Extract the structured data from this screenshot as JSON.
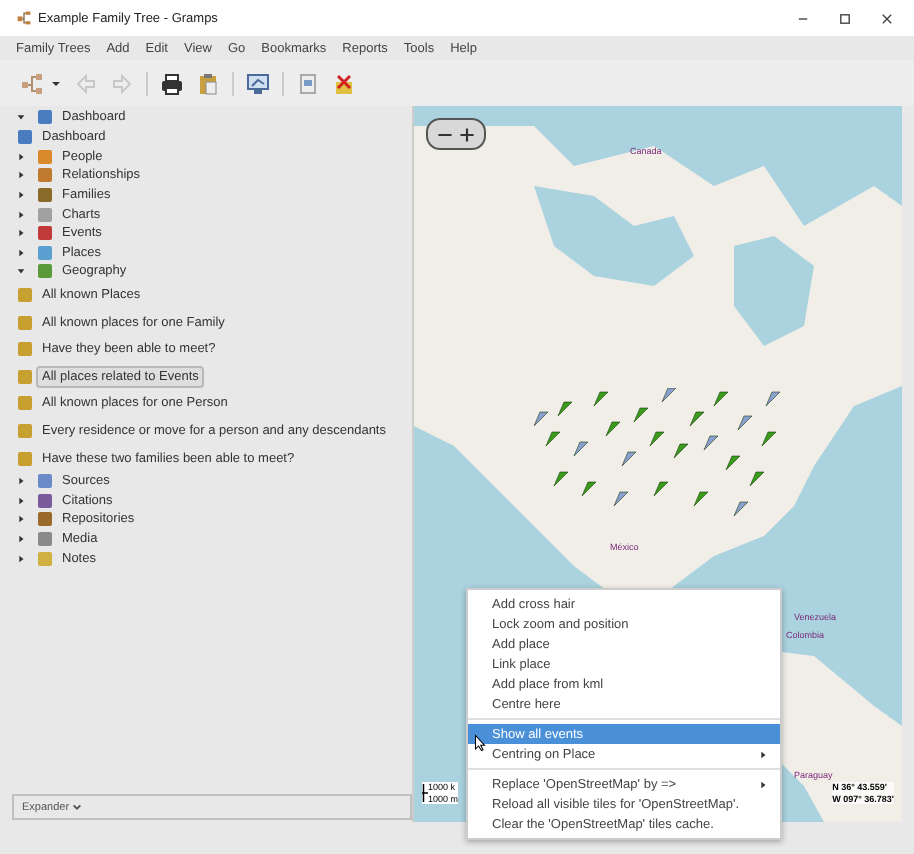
{
  "window": {
    "title": "Example Family Tree - Gramps"
  },
  "menu_bar": [
    "Family Trees",
    "Add",
    "Edit",
    "View",
    "Go",
    "Bookmarks",
    "Reports",
    "Tools",
    "Help"
  ],
  "sidebar": {
    "items": [
      {
        "label": "Dashboard",
        "expanded": true,
        "children": [
          {
            "label": "Dashboard",
            "selected": false
          }
        ]
      },
      {
        "label": "People",
        "expanded": false
      },
      {
        "label": "Relationships",
        "expanded": false
      },
      {
        "label": "Families",
        "expanded": false
      },
      {
        "label": "Charts",
        "expanded": false
      },
      {
        "label": "Events",
        "expanded": false
      },
      {
        "label": "Places",
        "expanded": false
      },
      {
        "label": "Geography",
        "expanded": true,
        "children": [
          {
            "label": "All known Places",
            "selected": false
          },
          {
            "label": "All known places for one Family",
            "selected": false
          },
          {
            "label": "Have they been able to meet?",
            "selected": false
          },
          {
            "label": "All places related to Events",
            "selected": true
          },
          {
            "label": "All known places for one Person",
            "selected": false
          },
          {
            "label": "Every residence or move for a person and any descendants",
            "selected": false
          },
          {
            "label": "Have these two families been able to meet?",
            "selected": false
          }
        ]
      },
      {
        "label": "Sources",
        "expanded": false
      },
      {
        "label": "Citations",
        "expanded": false
      },
      {
        "label": "Repositories",
        "expanded": false
      },
      {
        "label": "Media",
        "expanded": false
      },
      {
        "label": "Notes",
        "expanded": false
      }
    ],
    "expander": "Expander"
  },
  "map": {
    "labels": [
      "Canada",
      "México",
      "Venezuela",
      "Colombia",
      "Paraguay"
    ],
    "scale": [
      "1000 k",
      "1000 m"
    ],
    "coordinates": [
      "N 36° 43.559'",
      "W 097° 36.783'"
    ]
  },
  "context_menu": [
    {
      "kind": "item",
      "label": "Add cross hair",
      "selected": false
    },
    {
      "kind": "item",
      "label": "Lock zoom and position",
      "selected": false
    },
    {
      "kind": "item",
      "label": "Add place",
      "selected": false
    },
    {
      "kind": "item",
      "label": "Link place",
      "selected": false
    },
    {
      "kind": "item",
      "label": "Add place from kml",
      "selected": false
    },
    {
      "kind": "item",
      "label": "Centre here",
      "selected": false
    },
    {
      "kind": "separator"
    },
    {
      "kind": "item",
      "label": "Show all events",
      "selected": true
    },
    {
      "kind": "submenu",
      "label": "Centring on Place",
      "selected": false
    },
    {
      "kind": "separator"
    },
    {
      "kind": "submenu",
      "label": "Replace 'OpenStreetMap' by =>",
      "selected": false
    },
    {
      "kind": "item",
      "label": "Reload all visible tiles for 'OpenStreetMap'.",
      "selected": false
    },
    {
      "kind": "item",
      "label": "Clear the 'OpenStreetMap' tiles cache.",
      "selected": false
    }
  ]
}
